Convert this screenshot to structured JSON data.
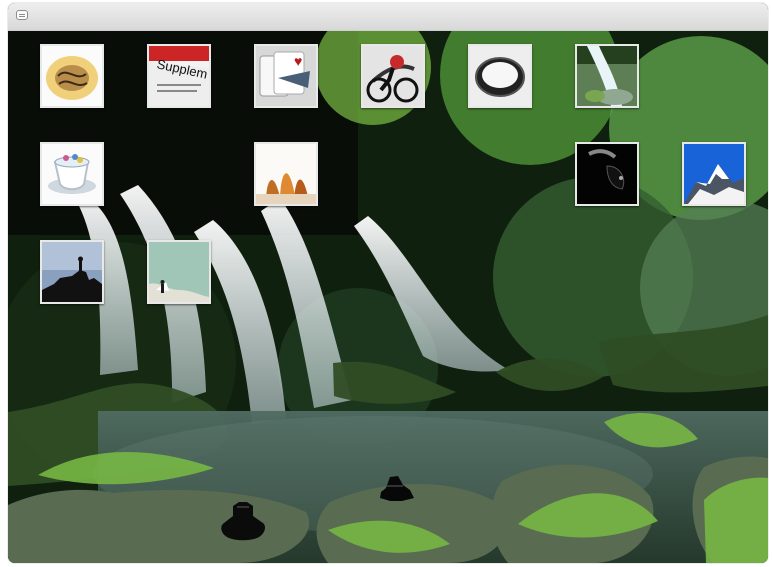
{
  "window": {
    "title": "",
    "icon_name": "speech-bubble-icon"
  },
  "desktop": {
    "background_name": "forest-waterfall-background",
    "icons": [
      {
        "name": "pasta-thumbnail"
      },
      {
        "name": "newspaper-thumbnail"
      },
      {
        "name": "playing-cards-thumbnail"
      },
      {
        "name": "cyclist-thumbnail"
      },
      {
        "name": "lens-cap-thumbnail"
      },
      {
        "name": "waterfall-thumbnail"
      },
      {
        "name": "teacup-thumbnail"
      },
      {
        "name": "autumn-trees-thumbnail"
      },
      {
        "name": "dark-object-thumbnail"
      },
      {
        "name": "snowy-mountain-thumbnail"
      },
      {
        "name": "silhouette-thumbnail"
      },
      {
        "name": "climber-thumbnail"
      }
    ],
    "text_newspaper": "Supplem"
  },
  "colors": {
    "foliage": "#3f7435",
    "water": "#dbe7ee",
    "tile_border": "#e8e8e8"
  }
}
